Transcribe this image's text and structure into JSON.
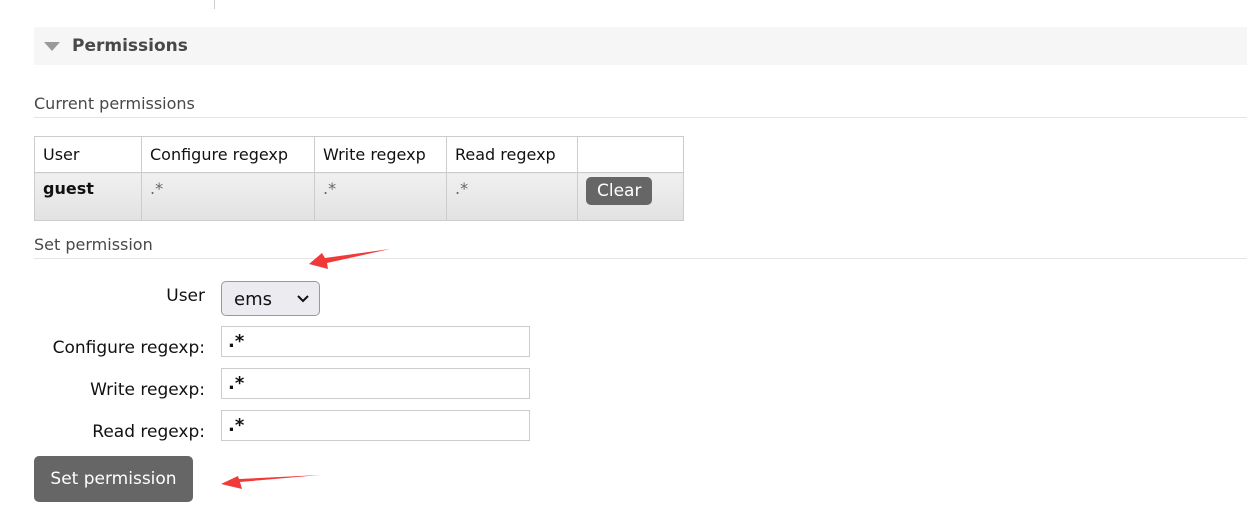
{
  "section": {
    "title": "Permissions",
    "icon": "triangle-down-icon"
  },
  "current": {
    "heading": "Current permissions",
    "columns": [
      "User",
      "Configure regexp",
      "Write regexp",
      "Read regexp",
      ""
    ],
    "rows": [
      {
        "user": "guest",
        "configure": ".*",
        "write": ".*",
        "read": ".*",
        "action": "Clear"
      }
    ]
  },
  "set": {
    "heading": "Set permission",
    "user_label": "User",
    "user_value": "ems",
    "configure_label": "Configure regexp:",
    "configure_value": ".*",
    "write_label": "Write regexp:",
    "write_value": ".*",
    "read_label": "Read regexp:",
    "read_value": ".*",
    "submit": "Set permission"
  },
  "colors": {
    "button": "#666666",
    "annotation_arrow": "#f03a3a"
  }
}
